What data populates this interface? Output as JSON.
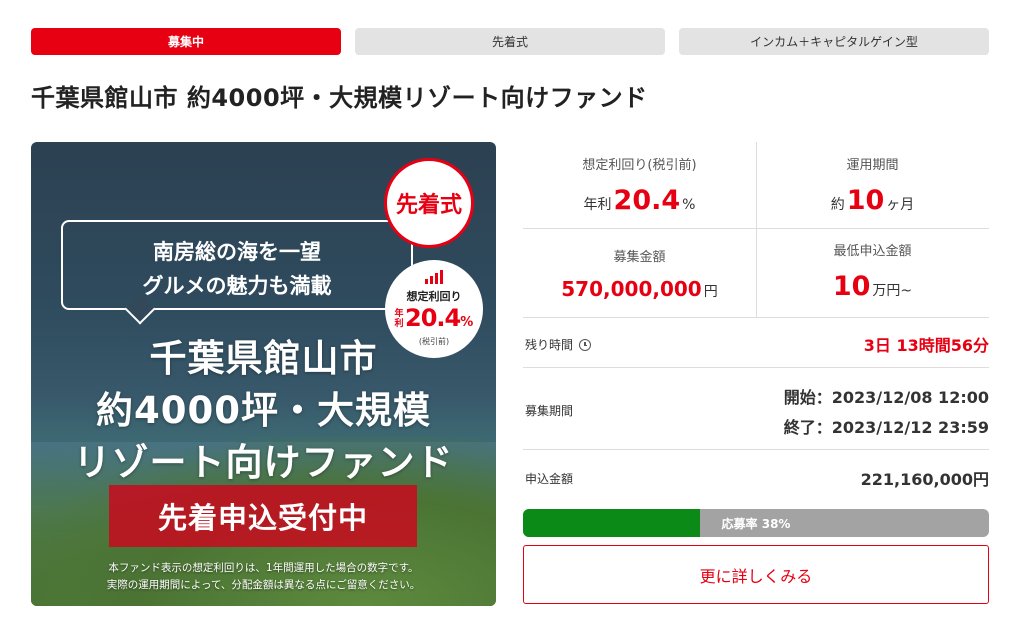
{
  "tags": [
    "募集中",
    "先着式",
    "インカム＋キャピタルゲイン型"
  ],
  "title": "千葉県館山市 約4000坪・大規模リゾート向けファンド",
  "hero": {
    "bubble_line1": "南房総の海を一望",
    "bubble_line2": "グルメの魅力も満載",
    "badge_first": "先着式",
    "yield_label": "想定利回り",
    "yield_prefix": "年利",
    "yield_value": "20.4",
    "yield_unit": "%",
    "yield_note": "(税引前)",
    "big_line1": "千葉県館山市",
    "big_line2": "約4000坪・大規模",
    "big_line3": "リゾート向けファンド",
    "banner": "先着申込受付中",
    "disclaimer1": "本ファンド表示の想定利回りは、1年間運用した場合の数字です。",
    "disclaimer2": "実際の運用期間によって、分配金額は異なる点にご留意ください。"
  },
  "stats": {
    "yield": {
      "caption": "想定利回り(税引前)",
      "prefix": "年利",
      "value": "20.4",
      "unit": "%"
    },
    "period": {
      "caption": "運用期間",
      "prefix": "約",
      "value": "10",
      "unit": "ヶ月"
    },
    "amount": {
      "caption": "募集金額",
      "value": "570,000,000",
      "unit": "円"
    },
    "minimum": {
      "caption": "最低申込金額",
      "value": "10",
      "unit": "万円~"
    }
  },
  "remaining": {
    "label": "残り時間",
    "value": "3日 13時間56分"
  },
  "recruit_period": {
    "label": "募集期間",
    "start": "開始：2023/12/08 12:00",
    "end": "終了：2023/12/12 23:59"
  },
  "applied": {
    "label": "申込金額",
    "value": "221,160,000円"
  },
  "progress": {
    "label": "応募率 38%",
    "rate": 0.38
  },
  "detail_button": "更に詳しくみる",
  "colors": {
    "accent": "#e60012",
    "progress_fill": "#0b8a18",
    "progress_track": "#a3a3a3",
    "tag_gray": "#e3e3e3"
  },
  "icons": {
    "clock": "clock-icon"
  }
}
